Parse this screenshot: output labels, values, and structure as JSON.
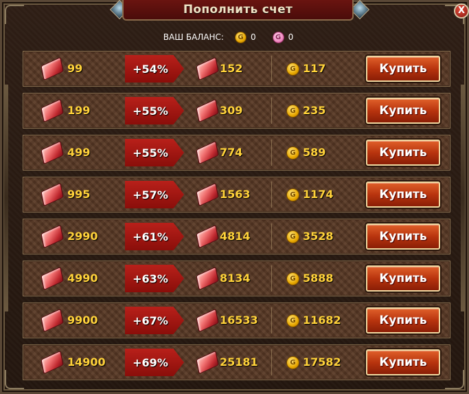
{
  "title": "Пополнить счет",
  "close_label": "X",
  "balance": {
    "label": "ВАШ БАЛАНС:",
    "gold_icon": "G",
    "gold_value": "0",
    "pink_icon": "G",
    "pink_value": "0"
  },
  "gold_icon_letter": "G",
  "buy_label": "Купить",
  "packages": [
    {
      "base": "99",
      "bonus": "+54%",
      "total": "152",
      "gold": "117"
    },
    {
      "base": "199",
      "bonus": "+55%",
      "total": "309",
      "gold": "235"
    },
    {
      "base": "499",
      "bonus": "+55%",
      "total": "774",
      "gold": "589"
    },
    {
      "base": "995",
      "bonus": "+57%",
      "total": "1563",
      "gold": "1174"
    },
    {
      "base": "2990",
      "bonus": "+61%",
      "total": "4814",
      "gold": "3528"
    },
    {
      "base": "4990",
      "bonus": "+63%",
      "total": "8134",
      "gold": "5888"
    },
    {
      "base": "9900",
      "bonus": "+67%",
      "total": "16533",
      "gold": "11682"
    },
    {
      "base": "14900",
      "bonus": "+69%",
      "total": "25181",
      "gold": "17582"
    }
  ],
  "colors": {
    "amount_text": "#ffd23a",
    "bonus_bg": "#b8201a",
    "buy_button": "#c8461a",
    "title_bar": "#5a1010"
  }
}
